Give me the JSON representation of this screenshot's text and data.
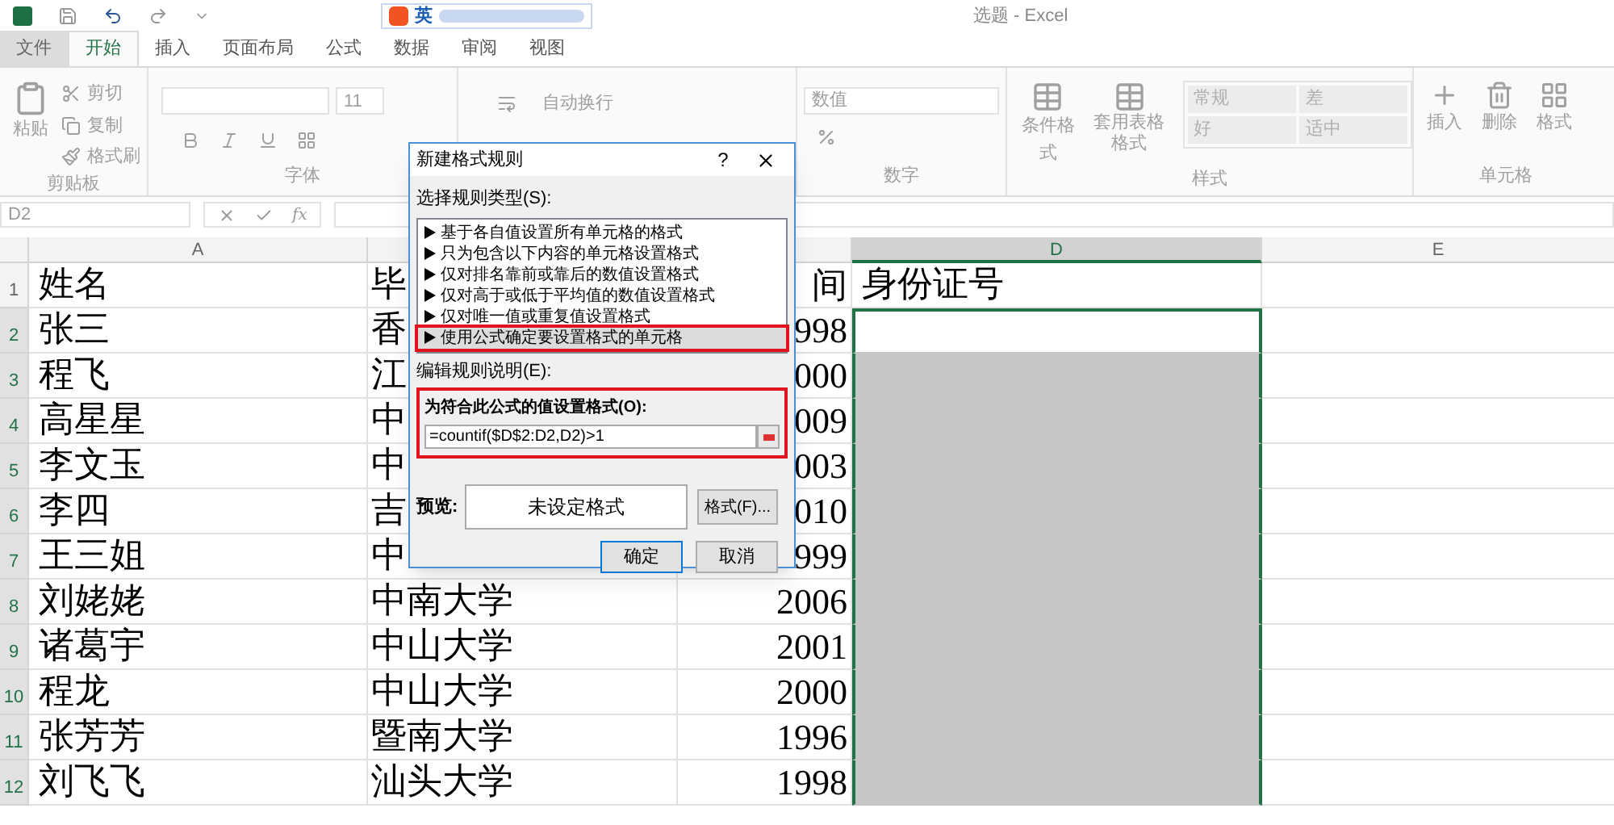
{
  "window": {
    "title": "选题 - Excel"
  },
  "quick_access": {
    "ime_label": "英"
  },
  "tabs": [
    {
      "label": "文件",
      "selected": false,
      "kind": "file"
    },
    {
      "label": "开始",
      "selected": true,
      "kind": "tab"
    },
    {
      "label": "插入",
      "selected": false,
      "kind": "tab"
    },
    {
      "label": "页面布局",
      "selected": false,
      "kind": "tab"
    },
    {
      "label": "公式",
      "selected": false,
      "kind": "tab"
    },
    {
      "label": "数据",
      "selected": false,
      "kind": "tab"
    },
    {
      "label": "审阅",
      "selected": false,
      "kind": "tab"
    },
    {
      "label": "视图",
      "selected": false,
      "kind": "tab"
    }
  ],
  "clipboard": {
    "paste": "粘贴",
    "cut": "剪切",
    "copy": "复制",
    "painter": "格式刷",
    "label": "剪贴板"
  },
  "font": {
    "size": "11",
    "label": "字体"
  },
  "alignment": {
    "wrap": "自动换行"
  },
  "number": {
    "format": "数值",
    "label": "数字"
  },
  "styles": {
    "conditional": "条件格式",
    "table": "套用表格格式",
    "presets": [
      "常规",
      "差",
      "好",
      "适中"
    ],
    "label": "样式"
  },
  "cells": {
    "insert": "插入",
    "delete": "删除",
    "format": "格式",
    "label": "单元格"
  },
  "formula_bar": {
    "name_box": "D2",
    "function_label": "fx"
  },
  "sheet": {
    "columns": [
      {
        "label": "A",
        "selected": false
      },
      {
        "label": "D",
        "selected": true
      },
      {
        "label": "E",
        "selected": false
      }
    ],
    "rows": [
      {
        "number": "1",
        "selected": false,
        "d_selected": false,
        "d_active": false,
        "a": "姓名",
        "b": "毕",
        "c": "间",
        "d": "身份证号"
      },
      {
        "number": "2",
        "selected": true,
        "d_selected": true,
        "d_active": true,
        "a": "张三",
        "b": "香",
        "c": "998"
      },
      {
        "number": "3",
        "selected": true,
        "d_selected": true,
        "d_active": false,
        "a": "程飞",
        "b": "江",
        "c": "000"
      },
      {
        "number": "4",
        "selected": true,
        "d_selected": true,
        "d_active": false,
        "a": "高星星",
        "b": "中",
        "c": "009"
      },
      {
        "number": "5",
        "selected": true,
        "d_selected": true,
        "d_active": false,
        "a": "李文玉",
        "b": "中",
        "c": "003"
      },
      {
        "number": "6",
        "selected": true,
        "d_selected": true,
        "d_active": false,
        "a": "李四",
        "b": "吉",
        "c": "010"
      },
      {
        "number": "7",
        "selected": true,
        "d_selected": true,
        "d_active": false,
        "a": "王三姐",
        "b": "中",
        "c": "999"
      },
      {
        "number": "8",
        "selected": true,
        "d_selected": true,
        "d_active": false,
        "a": "刘姥姥",
        "b": "中南大学",
        "c": "2006"
      },
      {
        "number": "9",
        "selected": true,
        "d_selected": true,
        "d_active": false,
        "a": "诸葛宇",
        "b": "中山大学",
        "c": "2001"
      },
      {
        "number": "10",
        "selected": true,
        "d_selected": true,
        "d_active": false,
        "a": "程龙",
        "b": "中山大学",
        "c": "2000"
      },
      {
        "number": "11",
        "selected": true,
        "d_selected": true,
        "d_active": false,
        "a": "张芳芳",
        "b": "暨南大学",
        "c": "1996"
      },
      {
        "number": "12",
        "selected": true,
        "d_selected": true,
        "d_active": false,
        "a": "刘飞飞",
        "b": "汕头大学",
        "c": "1998"
      }
    ]
  },
  "dialog": {
    "title": "新建格式规则",
    "help": "?",
    "rule_type_label": "选择规则类型(S):",
    "rule_types": [
      {
        "label": "基于各自值设置所有单元格的格式",
        "selected": false,
        "highlighted": false
      },
      {
        "label": "只为包含以下内容的单元格设置格式",
        "selected": false,
        "highlighted": false
      },
      {
        "label": "仅对排名靠前或靠后的数值设置格式",
        "selected": false,
        "highlighted": false
      },
      {
        "label": "仅对高于或低于平均值的数值设置格式",
        "selected": false,
        "highlighted": false
      },
      {
        "label": "仅对唯一值或重复值设置格式",
        "selected": false,
        "highlighted": false
      },
      {
        "label": "使用公式确定要设置格式的单元格",
        "selected": true,
        "highlighted": true
      }
    ],
    "description_label": "编辑规则说明(E):",
    "formula_label": "为符合此公式的值设置格式(O):",
    "formula_value": "=countif($D$2:D2,D2)>1",
    "formula_highlighted": true,
    "preview_label": "预览:",
    "preview_text": "未设定格式",
    "format_button": "格式(F)...",
    "ok": "确定",
    "cancel": "取消"
  }
}
